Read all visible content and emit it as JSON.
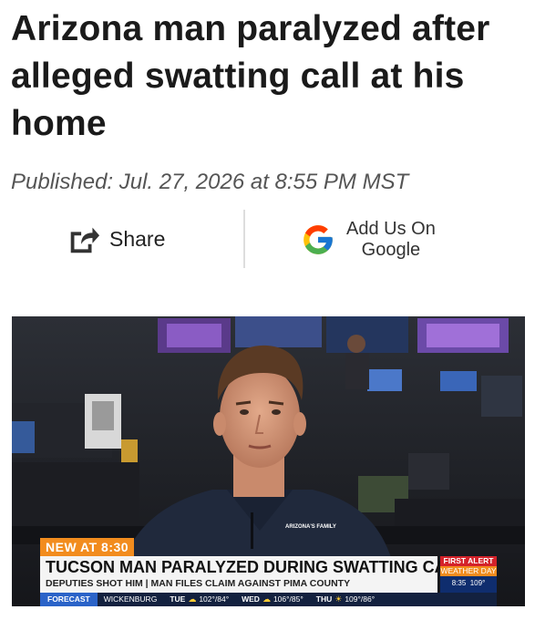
{
  "article": {
    "headline": "Arizona man paralyzed after alleged swatting call at his home",
    "published": "Published: Jul. 27, 2026 at 8:55 PM MST"
  },
  "actions": {
    "share_label": "Share",
    "share_icon": "share-arrow-icon",
    "google_label_line1": "Add Us On",
    "google_label_line2": "Google",
    "google_icon": "google-g-icon"
  },
  "video": {
    "station_logo": "ARIZONA'S FAMILY",
    "tag": "NEW AT 8:30",
    "headline": "TUCSON MAN PARALYZED DURING SWATTING CALL",
    "subline": "DEPUTIES SHOT HIM | MAN FILES CLAIM AGAINST PIMA COUNTY",
    "alert_line1": "FIRST ALERT",
    "alert_line2": "WEATHER DAY",
    "alert_time": "8:35",
    "alert_temp": "109°",
    "ticker": {
      "label": "FORECAST",
      "location": "WICKENBURG",
      "days": [
        {
          "day": "TUE",
          "temps": "102°/84°",
          "icon": "partly-cloudy-icon"
        },
        {
          "day": "WED",
          "temps": "106°/85°",
          "icon": "partly-cloudy-icon"
        },
        {
          "day": "THU",
          "temps": "109°/86°",
          "icon": "sun-icon"
        }
      ]
    }
  },
  "colors": {
    "headline_text": "#1a1a1a",
    "published_text": "#555555",
    "tag_orange": "#f28c1e",
    "alert_red": "#d4222a",
    "ticker_navy": "#13213f",
    "forecast_blue": "#2a63c8"
  }
}
